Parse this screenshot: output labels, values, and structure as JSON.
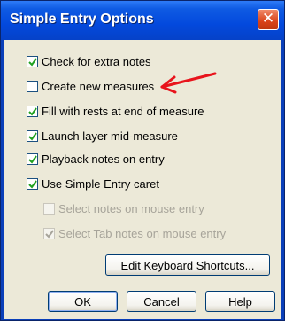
{
  "window": {
    "title": "Simple Entry Options",
    "close_glyph": "✕"
  },
  "options": [
    {
      "label": "Check for extra notes",
      "checked": true,
      "enabled": true
    },
    {
      "label": "Create new measures",
      "checked": false,
      "enabled": true
    },
    {
      "label": "Fill with rests at end of measure",
      "checked": true,
      "enabled": true
    },
    {
      "label": "Launch layer mid-measure",
      "checked": true,
      "enabled": true
    },
    {
      "label": "Playback notes on entry",
      "checked": true,
      "enabled": true
    },
    {
      "label": "Use Simple Entry caret",
      "checked": true,
      "enabled": true
    },
    {
      "label": "Select notes on mouse entry",
      "checked": false,
      "enabled": false
    },
    {
      "label": "Select Tab notes on mouse entry",
      "checked": true,
      "enabled": false
    }
  ],
  "buttons": {
    "edit_shortcuts": "Edit Keyboard Shortcuts...",
    "ok": "OK",
    "cancel": "Cancel",
    "help": "Help"
  },
  "annotation": {
    "arrow_color": "#e8141c"
  }
}
